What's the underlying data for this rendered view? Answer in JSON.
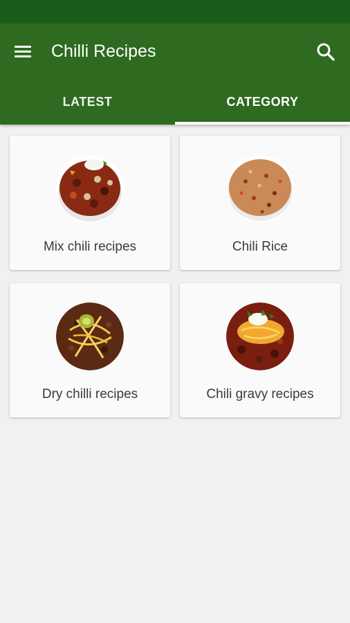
{
  "app": {
    "title": "Chilli Recipes"
  },
  "header": {
    "menu_icon": "hamburger-menu-icon",
    "search_icon": "search-icon"
  },
  "tabs": [
    {
      "label": "LATEST",
      "selected": false
    },
    {
      "label": "CATEGORY",
      "selected": true
    }
  ],
  "categories": [
    {
      "name": "Mix chili recipes",
      "image": "mixed-chili-bowl-image"
    },
    {
      "name": "Chili Rice",
      "image": "chili-rice-bowl-image"
    },
    {
      "name": "Dry chilli recipes",
      "image": "dry-chili-with-cheese-image"
    },
    {
      "name": "Chili gravy recipes",
      "image": "chili-gravy-with-cheese-image"
    }
  ],
  "colors": {
    "status_bar": "#1a5c1a",
    "app_bar": "#2e6a20",
    "background": "#f1f1f1",
    "card": "#fafafa"
  }
}
